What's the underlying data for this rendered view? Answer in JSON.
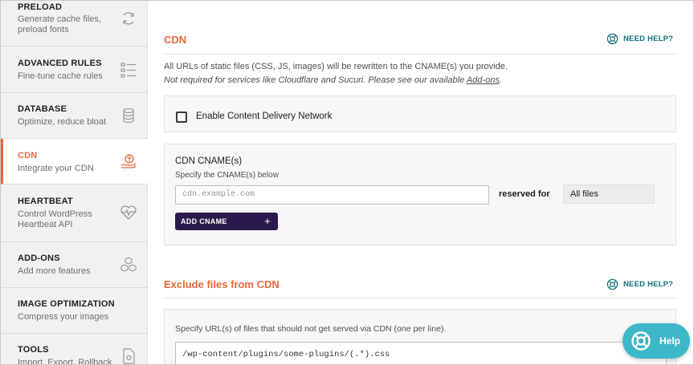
{
  "sidebar": {
    "items": [
      {
        "title": "PRELOAD",
        "desc": "Generate cache files, preload fonts",
        "icon": "refresh-icon",
        "active": false
      },
      {
        "title": "ADVANCED RULES",
        "desc": "Fine-tune cache rules",
        "icon": "list-icon",
        "active": false
      },
      {
        "title": "DATABASE",
        "desc": "Optimize, reduce bloat",
        "icon": "database-icon",
        "active": false
      },
      {
        "title": "CDN",
        "desc": "Integrate your CDN",
        "icon": "cdn-hand-icon",
        "active": true
      },
      {
        "title": "HEARTBEAT",
        "desc": "Control WordPress Heartbeat API",
        "icon": "heartbeat-icon",
        "active": false
      },
      {
        "title": "ADD-ONS",
        "desc": "Add more features",
        "icon": "cubes-icon",
        "active": false
      },
      {
        "title": "IMAGE OPTIMIZATION",
        "desc": "Compress your images",
        "icon": "",
        "active": false
      },
      {
        "title": "TOOLS",
        "desc": "Import, Export, Rollback",
        "icon": "tools-file-icon",
        "active": false
      }
    ]
  },
  "cdn": {
    "title": "CDN",
    "need_help": "NEED HELP?",
    "intro": "All URLs of static files (CSS, JS, images) will be rewritten to the CNAME(s) you provide.",
    "note_prefix": "Not required for services like Cloudflare and Sucuri. Please see our available ",
    "note_link": "Add-ons",
    "note_suffix": ".",
    "enable_label": "Enable Content Delivery Network",
    "enable_checked": false,
    "cname_title": "CDN CNAME(s)",
    "cname_sub": "Specify the CNAME(s) below",
    "cname_placeholder": "cdn.example.com",
    "reserved_label": "reserved for",
    "reserved_value": "All files",
    "add_cname": "ADD CNAME",
    "add_plus": "+"
  },
  "exclude": {
    "title": "Exclude files from CDN",
    "need_help": "NEED HELP?",
    "desc": "Specify URL(s) of files that should not get served via CDN (one per line).",
    "textarea_value": "/wp-content/plugins/some-plugins/(.*).css"
  },
  "help_fab": {
    "label": "Help"
  },
  "colors": {
    "accent": "#e8673a",
    "teal": "#0e6f7d",
    "button": "#2a1a4c",
    "fab": "#3db8c8"
  }
}
